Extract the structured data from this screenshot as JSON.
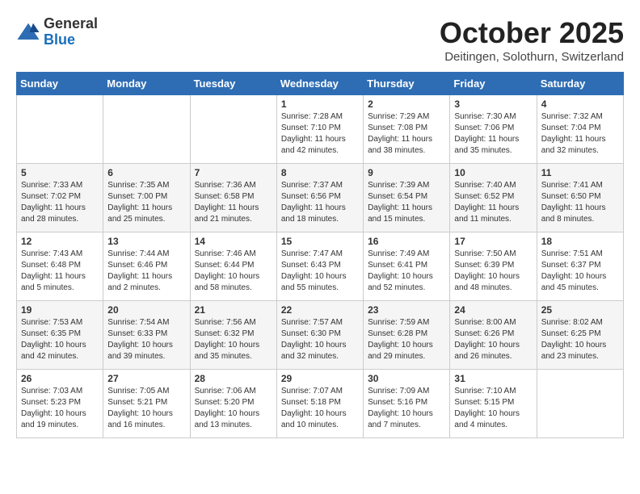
{
  "header": {
    "logo_line1": "General",
    "logo_line2": "Blue",
    "month": "October 2025",
    "location": "Deitingen, Solothurn, Switzerland"
  },
  "days_of_week": [
    "Sunday",
    "Monday",
    "Tuesday",
    "Wednesday",
    "Thursday",
    "Friday",
    "Saturday"
  ],
  "weeks": [
    [
      {
        "day": "",
        "info": ""
      },
      {
        "day": "",
        "info": ""
      },
      {
        "day": "",
        "info": ""
      },
      {
        "day": "1",
        "info": "Sunrise: 7:28 AM\nSunset: 7:10 PM\nDaylight: 11 hours\nand 42 minutes."
      },
      {
        "day": "2",
        "info": "Sunrise: 7:29 AM\nSunset: 7:08 PM\nDaylight: 11 hours\nand 38 minutes."
      },
      {
        "day": "3",
        "info": "Sunrise: 7:30 AM\nSunset: 7:06 PM\nDaylight: 11 hours\nand 35 minutes."
      },
      {
        "day": "4",
        "info": "Sunrise: 7:32 AM\nSunset: 7:04 PM\nDaylight: 11 hours\nand 32 minutes."
      }
    ],
    [
      {
        "day": "5",
        "info": "Sunrise: 7:33 AM\nSunset: 7:02 PM\nDaylight: 11 hours\nand 28 minutes."
      },
      {
        "day": "6",
        "info": "Sunrise: 7:35 AM\nSunset: 7:00 PM\nDaylight: 11 hours\nand 25 minutes."
      },
      {
        "day": "7",
        "info": "Sunrise: 7:36 AM\nSunset: 6:58 PM\nDaylight: 11 hours\nand 21 minutes."
      },
      {
        "day": "8",
        "info": "Sunrise: 7:37 AM\nSunset: 6:56 PM\nDaylight: 11 hours\nand 18 minutes."
      },
      {
        "day": "9",
        "info": "Sunrise: 7:39 AM\nSunset: 6:54 PM\nDaylight: 11 hours\nand 15 minutes."
      },
      {
        "day": "10",
        "info": "Sunrise: 7:40 AM\nSunset: 6:52 PM\nDaylight: 11 hours\nand 11 minutes."
      },
      {
        "day": "11",
        "info": "Sunrise: 7:41 AM\nSunset: 6:50 PM\nDaylight: 11 hours\nand 8 minutes."
      }
    ],
    [
      {
        "day": "12",
        "info": "Sunrise: 7:43 AM\nSunset: 6:48 PM\nDaylight: 11 hours\nand 5 minutes."
      },
      {
        "day": "13",
        "info": "Sunrise: 7:44 AM\nSunset: 6:46 PM\nDaylight: 11 hours\nand 2 minutes."
      },
      {
        "day": "14",
        "info": "Sunrise: 7:46 AM\nSunset: 6:44 PM\nDaylight: 10 hours\nand 58 minutes."
      },
      {
        "day": "15",
        "info": "Sunrise: 7:47 AM\nSunset: 6:43 PM\nDaylight: 10 hours\nand 55 minutes."
      },
      {
        "day": "16",
        "info": "Sunrise: 7:49 AM\nSunset: 6:41 PM\nDaylight: 10 hours\nand 52 minutes."
      },
      {
        "day": "17",
        "info": "Sunrise: 7:50 AM\nSunset: 6:39 PM\nDaylight: 10 hours\nand 48 minutes."
      },
      {
        "day": "18",
        "info": "Sunrise: 7:51 AM\nSunset: 6:37 PM\nDaylight: 10 hours\nand 45 minutes."
      }
    ],
    [
      {
        "day": "19",
        "info": "Sunrise: 7:53 AM\nSunset: 6:35 PM\nDaylight: 10 hours\nand 42 minutes."
      },
      {
        "day": "20",
        "info": "Sunrise: 7:54 AM\nSunset: 6:33 PM\nDaylight: 10 hours\nand 39 minutes."
      },
      {
        "day": "21",
        "info": "Sunrise: 7:56 AM\nSunset: 6:32 PM\nDaylight: 10 hours\nand 35 minutes."
      },
      {
        "day": "22",
        "info": "Sunrise: 7:57 AM\nSunset: 6:30 PM\nDaylight: 10 hours\nand 32 minutes."
      },
      {
        "day": "23",
        "info": "Sunrise: 7:59 AM\nSunset: 6:28 PM\nDaylight: 10 hours\nand 29 minutes."
      },
      {
        "day": "24",
        "info": "Sunrise: 8:00 AM\nSunset: 6:26 PM\nDaylight: 10 hours\nand 26 minutes."
      },
      {
        "day": "25",
        "info": "Sunrise: 8:02 AM\nSunset: 6:25 PM\nDaylight: 10 hours\nand 23 minutes."
      }
    ],
    [
      {
        "day": "26",
        "info": "Sunrise: 7:03 AM\nSunset: 5:23 PM\nDaylight: 10 hours\nand 19 minutes."
      },
      {
        "day": "27",
        "info": "Sunrise: 7:05 AM\nSunset: 5:21 PM\nDaylight: 10 hours\nand 16 minutes."
      },
      {
        "day": "28",
        "info": "Sunrise: 7:06 AM\nSunset: 5:20 PM\nDaylight: 10 hours\nand 13 minutes."
      },
      {
        "day": "29",
        "info": "Sunrise: 7:07 AM\nSunset: 5:18 PM\nDaylight: 10 hours\nand 10 minutes."
      },
      {
        "day": "30",
        "info": "Sunrise: 7:09 AM\nSunset: 5:16 PM\nDaylight: 10 hours\nand 7 minutes."
      },
      {
        "day": "31",
        "info": "Sunrise: 7:10 AM\nSunset: 5:15 PM\nDaylight: 10 hours\nand 4 minutes."
      },
      {
        "day": "",
        "info": ""
      }
    ]
  ]
}
